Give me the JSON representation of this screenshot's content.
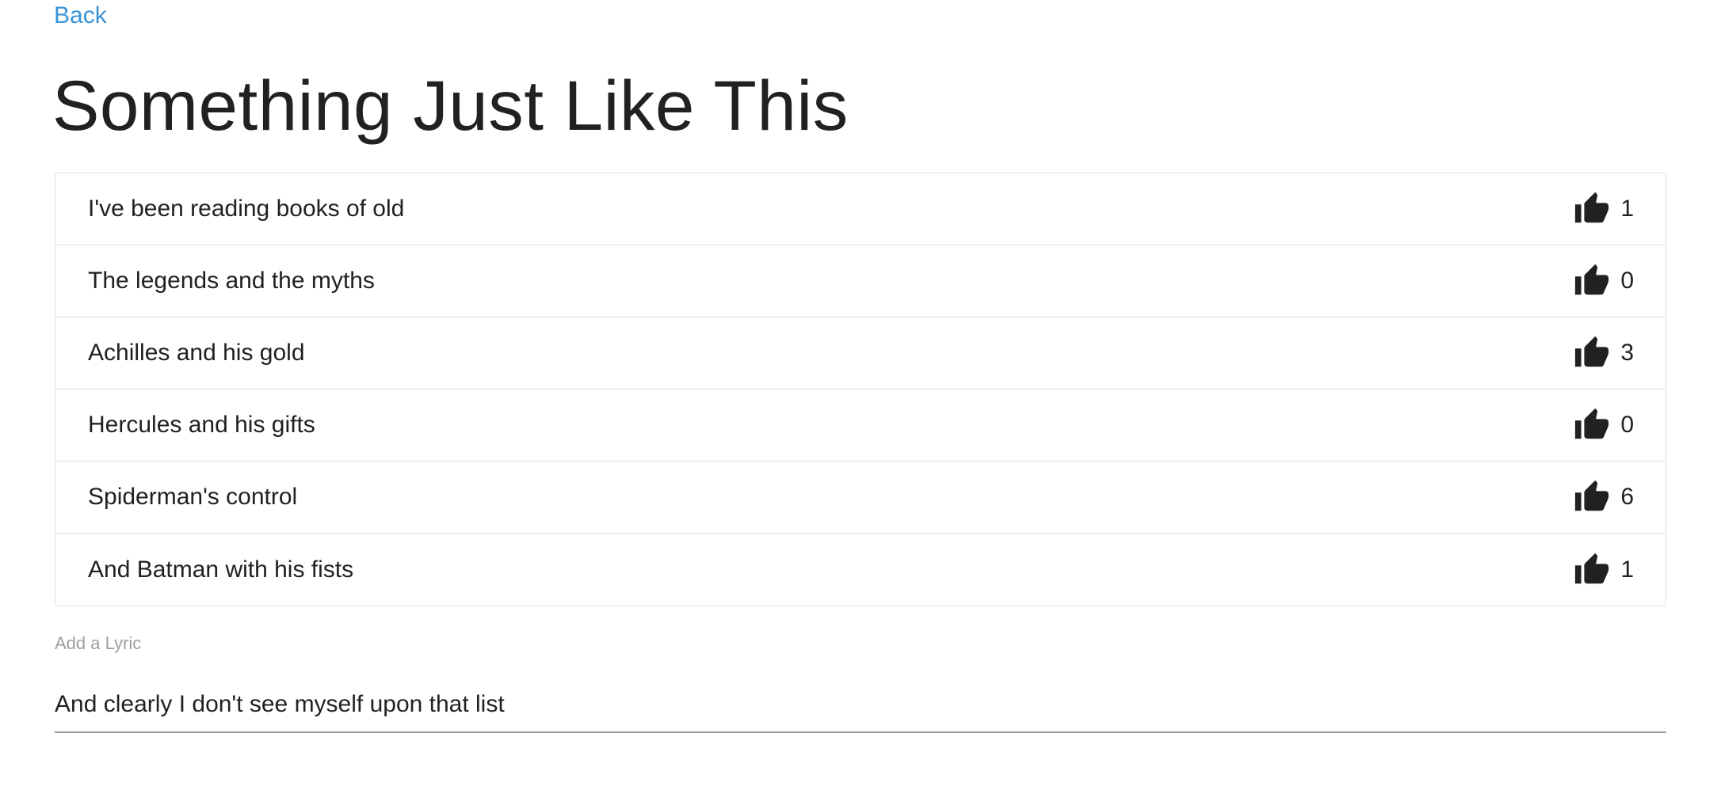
{
  "nav": {
    "back_label": "Back"
  },
  "song": {
    "title": "Something Just Like This"
  },
  "lyrics": [
    {
      "text": "I've been reading books of old",
      "likes": "1"
    },
    {
      "text": "The legends and the myths",
      "likes": "0"
    },
    {
      "text": "Achilles and his gold",
      "likes": "3"
    },
    {
      "text": "Hercules and his gifts",
      "likes": "0"
    },
    {
      "text": "Spiderman's control",
      "likes": "6"
    },
    {
      "text": "And Batman with his fists",
      "likes": "1"
    }
  ],
  "add_lyric": {
    "label": "Add a Lyric",
    "value": "And clearly I don't see myself upon that list"
  },
  "icons": {
    "like": "thumb-up-icon"
  },
  "colors": {
    "link": "#3a94d7",
    "text": "#212121",
    "muted": "#9e9e9e",
    "border": "#e0e0e0"
  }
}
